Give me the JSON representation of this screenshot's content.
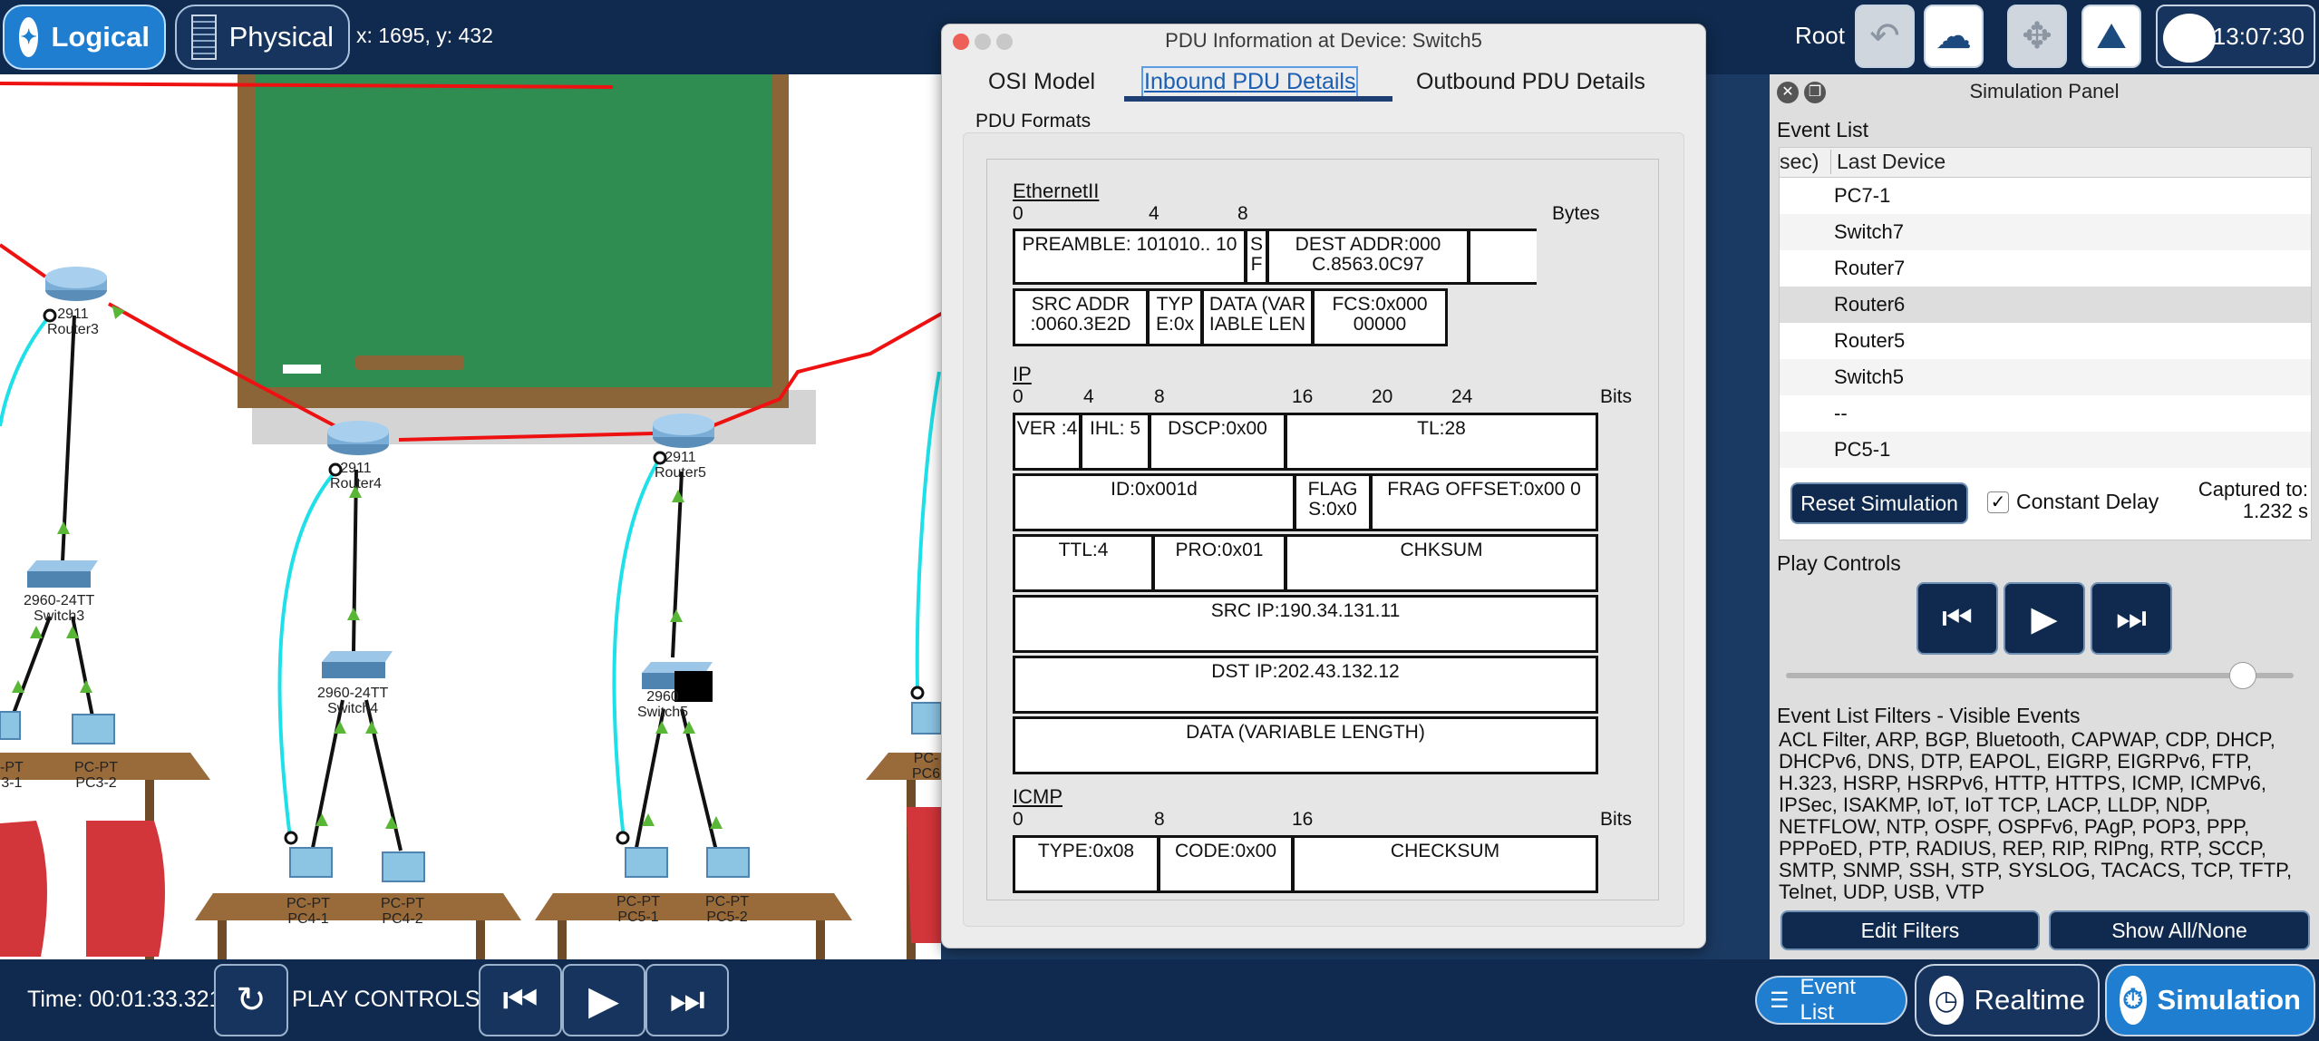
{
  "topbar": {
    "logical_label": "Logical",
    "physical_label": "Physical",
    "coords": "x: 1695, y: 432",
    "root_label": "Root",
    "clock": "13:07:30"
  },
  "workspace": {
    "devices": [
      {
        "model": "2911",
        "name": "Router3"
      },
      {
        "model": "2911",
        "name": "Router4"
      },
      {
        "model": "2911",
        "name": "Router5"
      },
      {
        "model": "2960-24TT",
        "name": "Switch3"
      },
      {
        "model": "2960-24TT",
        "name": "Switch4"
      },
      {
        "model": "2960",
        "name": "Switch5"
      },
      {
        "model": "PC-PT",
        "name": "PC3-2"
      },
      {
        "model": "PC-PT",
        "name": "PC4-1"
      },
      {
        "model": "PC-PT",
        "name": "PC4-2"
      },
      {
        "model": "PC-PT",
        "name": "PC5-1"
      },
      {
        "model": "PC-PT",
        "name": "PC5-2"
      },
      {
        "model": "PC-",
        "name": "PC6"
      },
      {
        "model": "-PT",
        "name": "3-1"
      }
    ]
  },
  "pdu": {
    "title": "PDU Information at Device: Switch5",
    "tabs": [
      "OSI Model",
      "Inbound PDU Details",
      "Outbound PDU Details"
    ],
    "formats_label": "PDU Formats",
    "ethernet": {
      "header": "EthernetII",
      "scale": [
        "0",
        "4",
        "8"
      ],
      "unit": "Bytes",
      "cells": [
        "PREAMBLE: 101010.. 10",
        "S F",
        "DEST ADDR:000 C.8563.0C97",
        "",
        "SRC ADDR :0060.3E2D",
        "TYP E:0x",
        "DATA (VAR IABLE LEN",
        "FCS:0x000 00000"
      ]
    },
    "ip": {
      "header": "IP",
      "scale": [
        "0",
        "4",
        "8",
        "16",
        "20",
        "24"
      ],
      "unit": "Bits",
      "cells": [
        "VER :4",
        "IHL: 5",
        "DSCP:0x00",
        "TL:28",
        "ID:0x001d",
        "FLAG S:0x0",
        "FRAG OFFSET:0x00 0",
        "TTL:4",
        "PRO:0x01",
        "CHKSUM",
        "SRC IP:190.34.131.11",
        "DST IP:202.43.132.12",
        "DATA (VARIABLE LENGTH)"
      ]
    },
    "icmp": {
      "header": "ICMP",
      "scale": [
        "0",
        "8",
        "16"
      ],
      "unit": "Bits",
      "cells": [
        "TYPE:0x08",
        "CODE:0x00",
        "CHECKSUM"
      ]
    }
  },
  "sim": {
    "title": "Simulation Panel",
    "event_list_label": "Event List",
    "columns": [
      "sec)",
      "Last Device"
    ],
    "events": [
      "PC7-1",
      "Switch7",
      "Router7",
      "Router6",
      "Router5",
      "Switch5",
      "--",
      "PC5-1"
    ],
    "reset_label": "Reset Simulation",
    "constant_delay_label": "Constant Delay",
    "captured_label": "Captured to:",
    "captured_value": "1.232 s",
    "play_controls_label": "Play Controls",
    "slider_position": 0.9,
    "filters_title": "Event List Filters - Visible Events",
    "filters_text": "ACL Filter, ARP, BGP, Bluetooth, CAPWAP, CDP, DHCP, DHCPv6, DNS, DTP, EAPOL, EIGRP, EIGRPv6, FTP, H.323, HSRP, HSRPv6, HTTP, HTTPS, ICMP, ICMPv6, IPSec, ISAKMP, IoT, IoT TCP, LACP, LLDP, NDP, NETFLOW, NTP, OSPF, OSPFv6, PAgP, POP3, PPP, PPPoED, PTP, RADIUS, REP, RIP, RIPng, RTP, SCCP, SMTP, SNMP, SSH, STP, SYSLOG, TACACS, TCP, TFTP, Telnet, UDP, USB, VTP",
    "edit_filters_label": "Edit Filters",
    "show_all_label": "Show All/None"
  },
  "bottom": {
    "time_label": "Time: 00:01:33.321",
    "play_controls_label": "PLAY CONTROLS:",
    "event_list_label": "Event List",
    "realtime_label": "Realtime",
    "simulation_label": "Simulation"
  }
}
